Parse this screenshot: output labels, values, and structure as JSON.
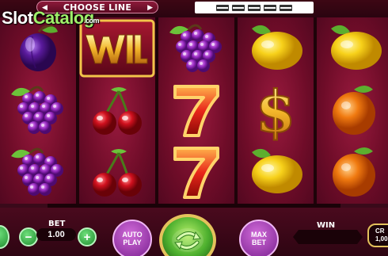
{
  "watermark": {
    "main": "Slot",
    "tail": "Catalog",
    "suffix": ".com"
  },
  "header": {
    "choose_line_label": "CHOOSE LINE",
    "prev_arrow": "◀",
    "next_arrow": "▶",
    "line_indicators": 5
  },
  "reels": [
    [
      "plum",
      "grapes",
      "grapes"
    ],
    [
      "wild",
      "cherries",
      "cherries"
    ],
    [
      "grapes",
      "seven",
      "seven"
    ],
    [
      "lemon",
      "dollar",
      "lemon"
    ],
    [
      "lemon",
      "orange",
      "orange"
    ]
  ],
  "controls": {
    "bet_label": "BET",
    "bet_value": "1.00",
    "minus_symbol": "−",
    "plus_symbol": "+",
    "auto_play_line1": "AUTO",
    "auto_play_line2": "PLAY",
    "max_bet_line1": "MAX",
    "max_bet_line2": "BET",
    "win_label": "WIN",
    "credit_label": "CR",
    "credit_value": "1,00"
  },
  "colors": {
    "reel_bg": "#7a0f2e",
    "button_green": "#4caf2e",
    "button_purple": "#a23cb8",
    "gold": "#e4c25c"
  }
}
